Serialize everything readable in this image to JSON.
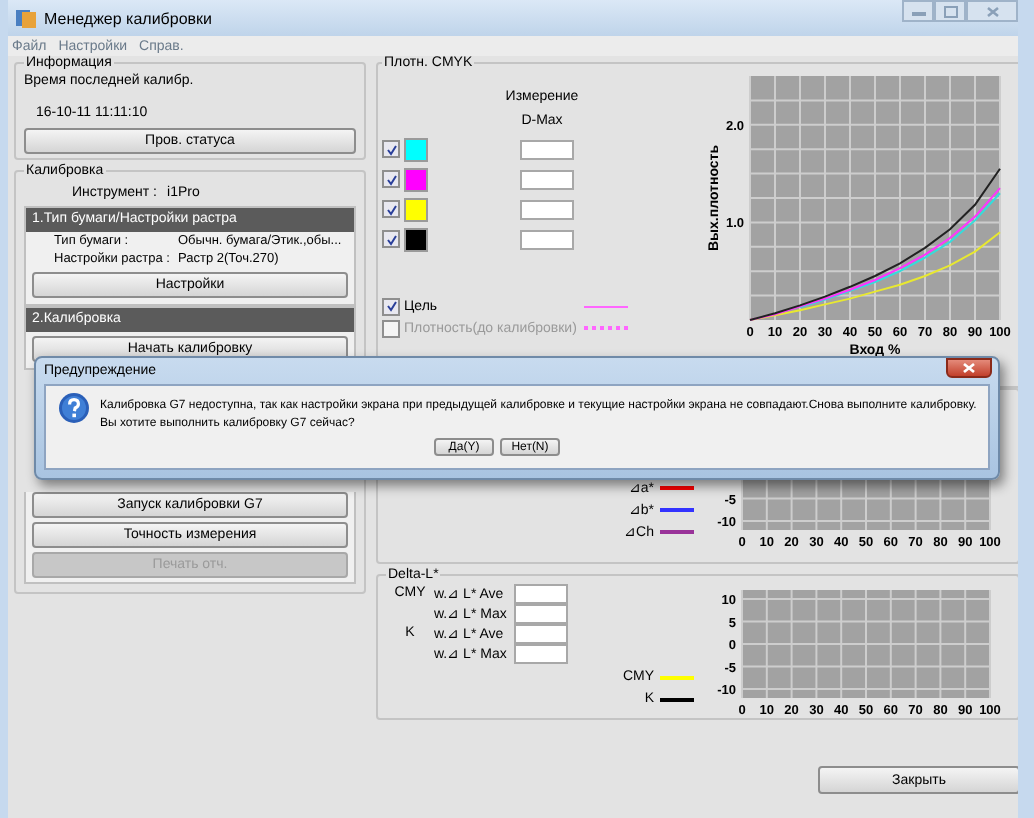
{
  "window": {
    "title": "Менеджер калибровки"
  },
  "menu": [
    {
      "label": "Файл"
    },
    {
      "label": "Настройки"
    },
    {
      "label": "Справ."
    }
  ],
  "info": {
    "title": "Информация",
    "last_calibration_label": "Время последней калибр.",
    "last_calibration_time": "16-10-11 11:11:10",
    "button": "Пров. статуса"
  },
  "calibration": {
    "title": "Калибровка",
    "instrument_label": "Инструмент :",
    "instrument": "i1Pro",
    "sections": [
      {
        "header": "1.Тип бумаги/Настройки растра",
        "rows": [
          {
            "label": "Тип бумаги :",
            "value": "Обычн. бумага/Этик.,обы..."
          },
          {
            "label": "Настройки растра :",
            "value": "Растр 2(Точ.270)"
          }
        ],
        "buttons": [
          {
            "label": "Настройки",
            "disabled": false
          }
        ]
      },
      {
        "header": "2.Калибровка",
        "buttons": [
          {
            "label": "Начать калибровку",
            "disabled": false
          }
        ]
      }
    ],
    "lower_buttons": [
      {
        "label": "Запуск калибровки G7",
        "disabled": false
      },
      {
        "label": "Точность измерения",
        "disabled": false
      },
      {
        "label": "Печать отч.",
        "disabled": true
      }
    ]
  },
  "cmyk_density": {
    "title": "Плотн. CMYK",
    "column_header": "Измерение",
    "column_subheader": "D-Max",
    "channels": [
      {
        "checked": true,
        "color": "#00ffff"
      },
      {
        "checked": true,
        "color": "#ff00ff"
      },
      {
        "checked": true,
        "color": "#ffff00"
      },
      {
        "checked": true,
        "color": "#000000"
      }
    ],
    "legend": [
      {
        "label": "Цель",
        "checked": true,
        "disabled": false,
        "kind": "solid",
        "color": "#ff66ff"
      },
      {
        "label": "Плотность(до калибровки)",
        "checked": false,
        "disabled": true,
        "kind": "dotted",
        "color": "#ff66ff"
      }
    ],
    "chart_data": {
      "type": "line",
      "grid": true,
      "xlabel": "Вход %",
      "ylabel": "Вых.плотность",
      "x": [
        0,
        10,
        20,
        30,
        40,
        50,
        60,
        70,
        80,
        90,
        100
      ],
      "xlim": [
        0,
        100
      ],
      "ylim": [
        0,
        2.5
      ],
      "xticks": [
        0,
        10,
        20,
        30,
        40,
        50,
        60,
        70,
        80,
        90,
        100
      ],
      "yticks": [
        {
          "value": 1,
          "label": "1.0"
        },
        {
          "value": 2,
          "label": "2.0"
        }
      ],
      "series": [
        {
          "color": "#e8e830",
          "values": [
            0,
            0.05,
            0.1,
            0.16,
            0.22,
            0.29,
            0.36,
            0.45,
            0.56,
            0.7,
            0.9
          ]
        },
        {
          "color": "#33dddd",
          "values": [
            null,
            null,
            0.13,
            0.21,
            0.3,
            0.39,
            0.5,
            0.64,
            0.8,
            1.02,
            1.3
          ]
        },
        {
          "color": "#ff33ff",
          "values": [
            0,
            0.06,
            0.14,
            0.22,
            0.31,
            0.41,
            0.53,
            0.67,
            0.84,
            1.06,
            1.35
          ]
        },
        {
          "color": "#222222",
          "values": [
            0,
            0.07,
            0.15,
            0.24,
            0.34,
            0.45,
            0.58,
            0.74,
            0.93,
            1.18,
            1.55
          ]
        }
      ]
    }
  },
  "delta_e": {
    "chart_data": {
      "type": "line",
      "grid": true,
      "categories": [
        "0",
        "10",
        "20",
        "30",
        "40",
        "50",
        "60",
        "70",
        "80",
        "90",
        "100"
      ],
      "ylim": [
        -12,
        12
      ],
      "yticks": [
        -10,
        -5
      ],
      "series": [
        {
          "name": "⊿a*",
          "color": "#ff0000",
          "values": [
            null,
            null,
            null,
            null,
            null,
            null,
            null,
            null,
            null,
            null,
            null
          ]
        },
        {
          "name": "⊿b*",
          "color": "#3333ff",
          "values": [
            null,
            null,
            null,
            null,
            null,
            null,
            null,
            null,
            null,
            null,
            null
          ]
        },
        {
          "name": "⊿Ch",
          "color": "#993399",
          "values": [
            null,
            null,
            null,
            null,
            null,
            null,
            null,
            null,
            null,
            null,
            null
          ]
        }
      ]
    }
  },
  "delta_l": {
    "title": "Delta-L*",
    "groups": [
      {
        "label": "CMY",
        "fields": [
          {
            "label": "w.⊿ L* Ave"
          },
          {
            "label": "w.⊿ L* Max"
          }
        ]
      },
      {
        "label": "K",
        "fields": [
          {
            "label": "w.⊿ L* Ave"
          },
          {
            "label": "w.⊿ L* Max"
          }
        ]
      }
    ],
    "chart_data": {
      "type": "line",
      "grid": true,
      "categories": [
        "0",
        "10",
        "20",
        "30",
        "40",
        "50",
        "60",
        "70",
        "80",
        "90",
        "100"
      ],
      "ylim": [
        -12,
        12
      ],
      "yticks": [
        -10,
        -5,
        0,
        5,
        10
      ],
      "series": [
        {
          "name": "CMY",
          "color": "#ffff00",
          "values": [
            null,
            null,
            null,
            null,
            null,
            null,
            null,
            null,
            null,
            null,
            null
          ]
        },
        {
          "name": "K",
          "color": "#000000",
          "values": [
            null,
            null,
            null,
            null,
            null,
            null,
            null,
            null,
            null,
            null,
            null
          ]
        }
      ]
    }
  },
  "close_button": "Закрыть",
  "dialog": {
    "title": "Предупреждение",
    "message": [
      "Калибровка G7 недоступна, так как настройки экрана при предыдущей калибровке и текущие настройки экрана не совпадают.Снова выполните калибровку.",
      "Вы хотите выполнить калибровку G7 сейчас?"
    ],
    "buttons": [
      {
        "label": "Да(Y)"
      },
      {
        "label": "Нет(N)"
      }
    ]
  }
}
